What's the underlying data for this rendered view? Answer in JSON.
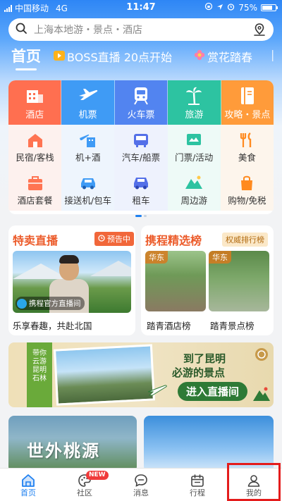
{
  "status_bar": {
    "carrier": "中国移动",
    "network": "4G",
    "time": "11:47",
    "battery": "75%",
    "battery_level": 0.75
  },
  "search": {
    "placeholder": "上海本地游・景点・酒店"
  },
  "top_tabs": [
    {
      "label": "首页"
    },
    {
      "label": "BOSS直播 20点开始"
    },
    {
      "label": "赏花踏春"
    }
  ],
  "main_categories": [
    {
      "label": "酒店",
      "color": "#ff6f50"
    },
    {
      "label": "机票",
      "color": "#3f9bf5"
    },
    {
      "label": "火车票",
      "color": "#5284f0"
    },
    {
      "label": "旅游",
      "color": "#2dc3a1"
    },
    {
      "label": "攻略・景点",
      "color": "#ff9b3a"
    }
  ],
  "sub_categories": [
    {
      "label": "民宿/客栈"
    },
    {
      "label": "机+酒"
    },
    {
      "label": "汽车/船票"
    },
    {
      "label": "门票/活动"
    },
    {
      "label": "美食"
    },
    {
      "label": "酒店套餐"
    },
    {
      "label": "接送机/包车"
    },
    {
      "label": "租车"
    },
    {
      "label": "周边游"
    },
    {
      "label": "购物/免税"
    }
  ],
  "promo_live": {
    "title": "特卖直播",
    "badge": "预告中",
    "tag": "携程官方直播间",
    "caption": "乐享春趣，共赴北国"
  },
  "promo_rank": {
    "title": "携程精选榜",
    "badge": "权威排行榜",
    "items": [
      {
        "tag": "华东",
        "caption": "踏青酒店榜"
      },
      {
        "tag": "华东",
        "caption": "踏青景点榜"
      }
    ]
  },
  "banner": {
    "vertical_text": "带你云游昆明石林",
    "line1": "到了昆明",
    "line2": "必游的景点",
    "button": "进入直播间"
  },
  "feed": {
    "left_title": "世外桃源"
  },
  "tabbar": [
    {
      "label": "首页",
      "active": true
    },
    {
      "label": "社区",
      "badge": "NEW"
    },
    {
      "label": "消息"
    },
    {
      "label": "行程"
    },
    {
      "label": "我的"
    }
  ]
}
